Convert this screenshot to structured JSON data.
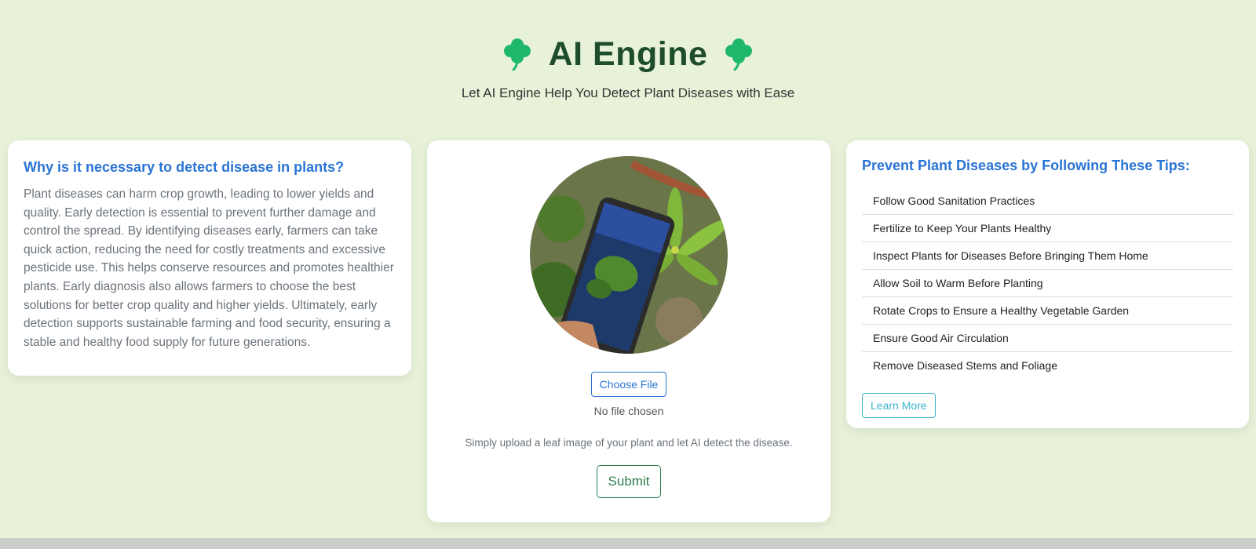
{
  "header": {
    "title": "AI Engine",
    "subtitle": "Let AI Engine Help You Detect Plant Diseases with Ease",
    "icons": [
      "clover-icon",
      "clover-icon"
    ]
  },
  "info_card": {
    "heading": "Why is it necessary to detect disease in plants?",
    "body": "Plant diseases can harm crop growth, leading to lower yields and quality. Early detection is essential to prevent further damage and control the spread. By identifying diseases early, farmers can take quick action, reducing the need for costly treatments and excessive pesticide use. This helps conserve resources and promotes healthier plants. Early diagnosis also allows farmers to choose the best solutions for better crop quality and higher yields. Ultimately, early detection supports sustainable farming and food security, ensuring a stable and healthy food supply for future generations."
  },
  "upload_card": {
    "choose_file_label": "Choose File",
    "file_status": "No file chosen",
    "hint": "Simply upload a leaf image of your plant and let AI detect the disease.",
    "submit_label": "Submit"
  },
  "tips_card": {
    "heading": "Prevent Plant Diseases by Following These Tips:",
    "tips": [
      "Follow Good Sanitation Practices",
      "Fertilize to Keep Your Plants Healthy",
      "Inspect Plants for Diseases Before Bringing Them Home",
      "Allow Soil to Warm Before Planting",
      "Rotate Crops to Ensure a Healthy Vegetable Garden",
      "Ensure Good Air Circulation",
      "Remove Diseased Stems and Foliage"
    ],
    "learn_more_label": "Learn More"
  },
  "colors": {
    "background": "#e8f2d9",
    "title": "#1e4d2b",
    "clover": "#1fb86a",
    "heading_blue": "#2a74d4",
    "submit_green": "#2e7d4f",
    "learn_more_teal": "#3cb4cc"
  }
}
